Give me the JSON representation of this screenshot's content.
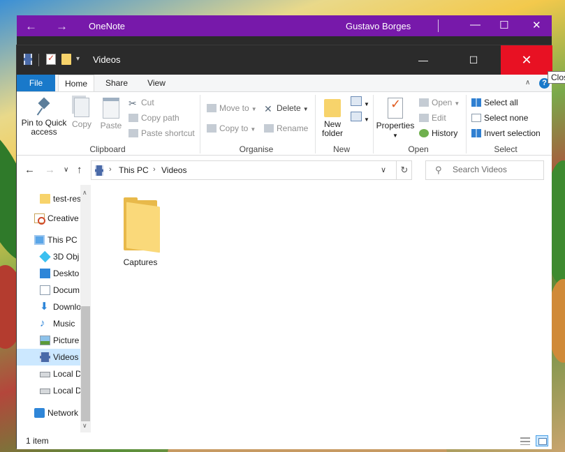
{
  "onenote": {
    "title": "OneNote",
    "user": "Gustavo Borges"
  },
  "explorer": {
    "title": "Videos",
    "tooltip": "Close",
    "tabs": [
      "File",
      "Home",
      "Share",
      "View"
    ],
    "ribbon": {
      "clipboard": {
        "label": "Clipboard",
        "pin_label_1": "Pin to Quick",
        "pin_label_2": "access",
        "copy": "Copy",
        "paste": "Paste",
        "cut": "Cut",
        "copy_path": "Copy path",
        "paste_shortcut": "Paste shortcut"
      },
      "organise": {
        "label": "Organise",
        "move_to": "Move to",
        "copy_to": "Copy to",
        "delete": "Delete",
        "rename": "Rename"
      },
      "new": {
        "label": "New",
        "new_folder_1": "New",
        "new_folder_2": "folder"
      },
      "open": {
        "label": "Open",
        "properties": "Properties",
        "open": "Open",
        "edit": "Edit",
        "history": "History"
      },
      "select": {
        "label": "Select",
        "select_all": "Select all",
        "select_none": "Select none",
        "invert_selection": "Invert selection"
      }
    },
    "address": {
      "crumbs": [
        "This PC",
        "Videos"
      ]
    },
    "search": {
      "placeholder": "Search Videos"
    },
    "nav_pane": [
      {
        "label": "test-res",
        "icon": "folder-icon"
      },
      {
        "label": "Creative",
        "icon": "creative-cloud-icon"
      },
      {
        "label": "This PC",
        "icon": "computer-icon"
      },
      {
        "label": "3D Obj",
        "icon": "3d-objects-icon"
      },
      {
        "label": "Deskto",
        "icon": "desktop-icon"
      },
      {
        "label": "Docum",
        "icon": "documents-icon"
      },
      {
        "label": "Downlo",
        "icon": "downloads-icon"
      },
      {
        "label": "Music",
        "icon": "music-icon"
      },
      {
        "label": "Picture",
        "icon": "pictures-icon"
      },
      {
        "label": "Videos",
        "icon": "videos-icon"
      },
      {
        "label": "Local D",
        "icon": "drive-icon"
      },
      {
        "label": "Local D",
        "icon": "drive-icon"
      },
      {
        "label": "Network",
        "icon": "network-icon"
      }
    ],
    "files": [
      {
        "name": "Captures",
        "icon": "folder-icon"
      }
    ],
    "status": {
      "count": "1 item"
    },
    "colors": {
      "accent": "#1979ca",
      "close": "#e81123",
      "onenote": "#7719aa",
      "selected": "#cce8ff"
    }
  }
}
